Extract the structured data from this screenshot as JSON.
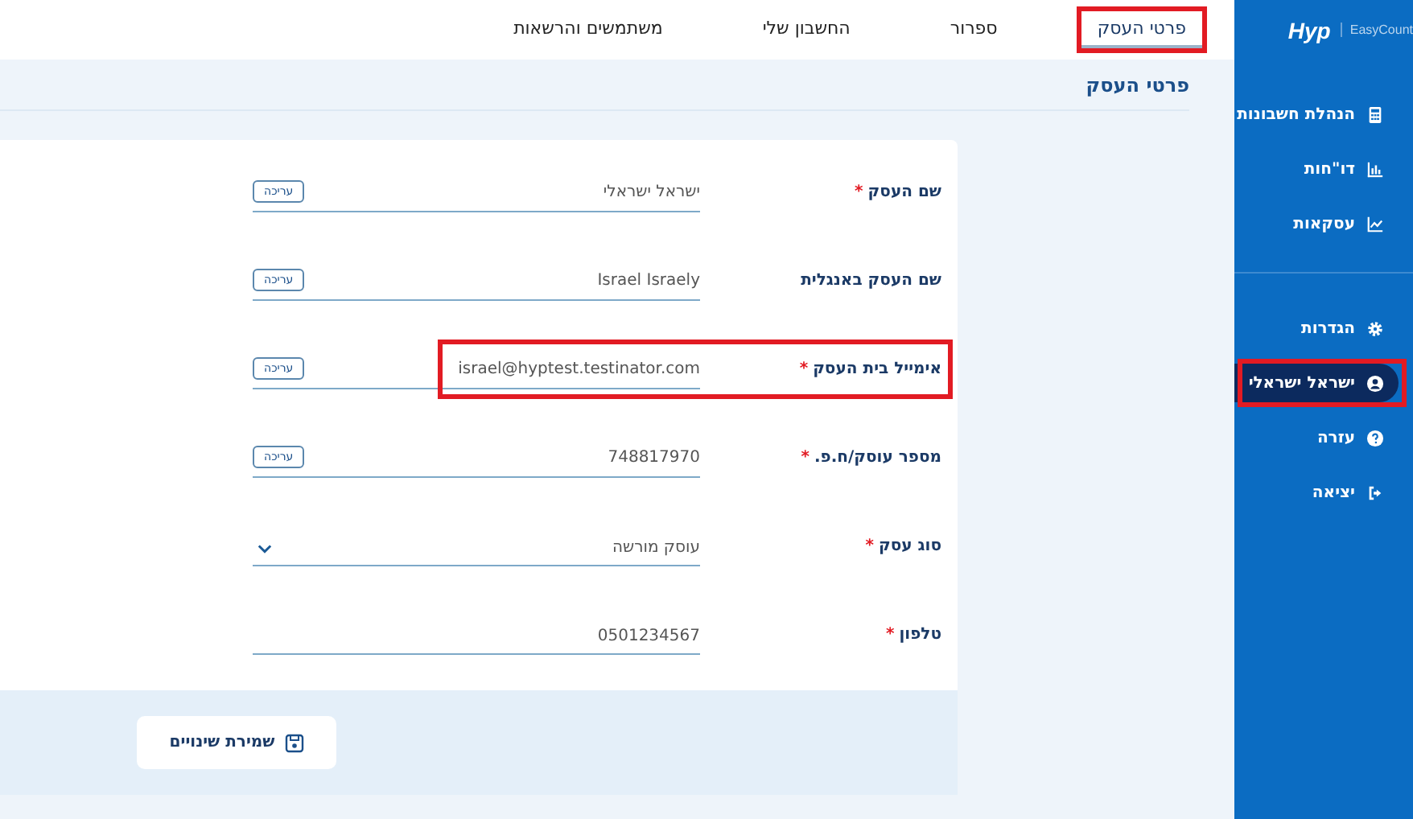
{
  "brand": {
    "logo": "Hyp",
    "product": "EasyCount"
  },
  "top_tabs": [
    {
      "label": "פרטי העסק",
      "selected": true,
      "highlighted": true
    },
    {
      "label": "ספרור",
      "selected": false,
      "highlighted": false
    },
    {
      "label": "החשבון שלי",
      "selected": false,
      "highlighted": false
    },
    {
      "label": "משתמשים והרשאות",
      "selected": false,
      "highlighted": false
    }
  ],
  "sidebar": {
    "groups": [
      [
        {
          "label": "הנהלת חשבונות",
          "selected": false,
          "highlighted": false
        },
        {
          "label": "דו\"חות",
          "selected": false,
          "highlighted": false
        },
        {
          "label": "עסקאות",
          "selected": false,
          "highlighted": false
        }
      ],
      [
        {
          "label": "הגדרות",
          "selected": false,
          "highlighted": false
        },
        {
          "label": "ישראל ישראלי",
          "selected": true,
          "highlighted": true
        },
        {
          "label": "עזרה",
          "selected": false,
          "highlighted": false
        },
        {
          "label": "יציאה",
          "selected": false,
          "highlighted": false
        }
      ]
    ]
  },
  "page_title": "פרטי העסק",
  "form": {
    "fields": [
      {
        "label": "שם העסק",
        "required_mark": "*",
        "kind": "editable",
        "value": "ישראל ישראלי",
        "action": "עריכה",
        "highlighted": false
      },
      {
        "label": "שם העסק באנגלית",
        "kind": "editable",
        "value": "Israel Israely",
        "action": "עריכה",
        "highlighted": false
      },
      {
        "label": "אימייל בית העסק",
        "required_mark": "*",
        "kind": "editable",
        "value": "israel@hyptest.testinator.com",
        "action": "עריכה",
        "highlighted": true
      },
      {
        "label": "מספר עוסק/ח.פ.",
        "required_mark": "*",
        "kind": "editable",
        "value": "748817970",
        "action": "עריכה",
        "highlighted": false
      },
      {
        "label": "סוג עסק",
        "required_mark": "*",
        "kind": "select",
        "value": "עוסק מורשה",
        "highlighted": false
      },
      {
        "label": "טלפון",
        "required_mark": "*",
        "kind": "text",
        "value": "0501234567",
        "highlighted": false
      }
    ],
    "save_button": "שמירת שינויים"
  }
}
